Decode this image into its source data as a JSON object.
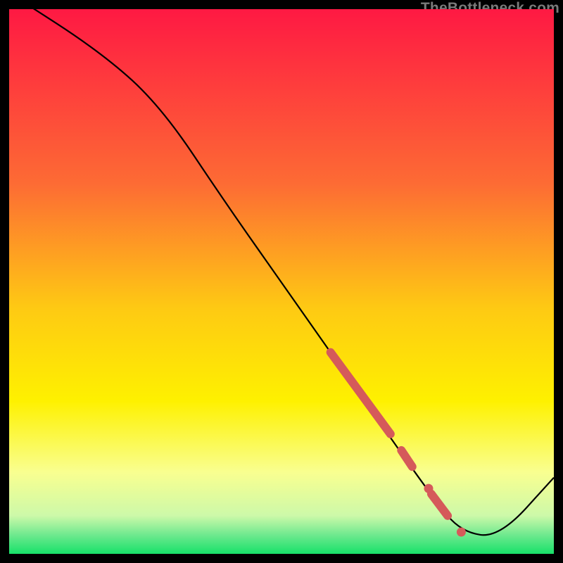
{
  "watermark": "TheBottleneck.com",
  "colors": {
    "gradient_top": "#fe1943",
    "gradient_mid1": "#fd8f2e",
    "gradient_mid2": "#fef100",
    "gradient_mid3": "#f7ff6f",
    "gradient_bottom_band": "#55e58a",
    "gradient_bottom": "#17e169",
    "line": "#000000",
    "marker": "#d55a5a"
  },
  "chart_data": {
    "type": "line",
    "title": "",
    "xlabel": "",
    "ylabel": "",
    "xlim": [
      0,
      100
    ],
    "ylim": [
      0,
      100
    ],
    "series": [
      {
        "name": "bottleneck-curve",
        "x": [
          0,
          17,
          28,
          40,
          52,
          66,
          78,
          83,
          90,
          100
        ],
        "y": [
          103,
          92,
          82,
          64,
          47,
          27,
          10,
          4,
          3,
          14
        ]
      }
    ],
    "markers": [
      {
        "name": "highlight-segment-upper",
        "type": "thick-line",
        "x": [
          59,
          70
        ],
        "y": [
          37,
          22
        ]
      },
      {
        "name": "highlight-segment-mid",
        "type": "thick-line",
        "x": [
          72,
          74
        ],
        "y": [
          19,
          16
        ]
      },
      {
        "name": "highlight-dot-lower",
        "type": "dot",
        "x": 77,
        "y": 12
      },
      {
        "name": "highlight-segment-lower",
        "type": "thick-line",
        "x": [
          77.5,
          80.5
        ],
        "y": [
          11,
          7
        ]
      },
      {
        "name": "highlight-dot-min",
        "type": "dot",
        "x": 83,
        "y": 4
      }
    ]
  }
}
